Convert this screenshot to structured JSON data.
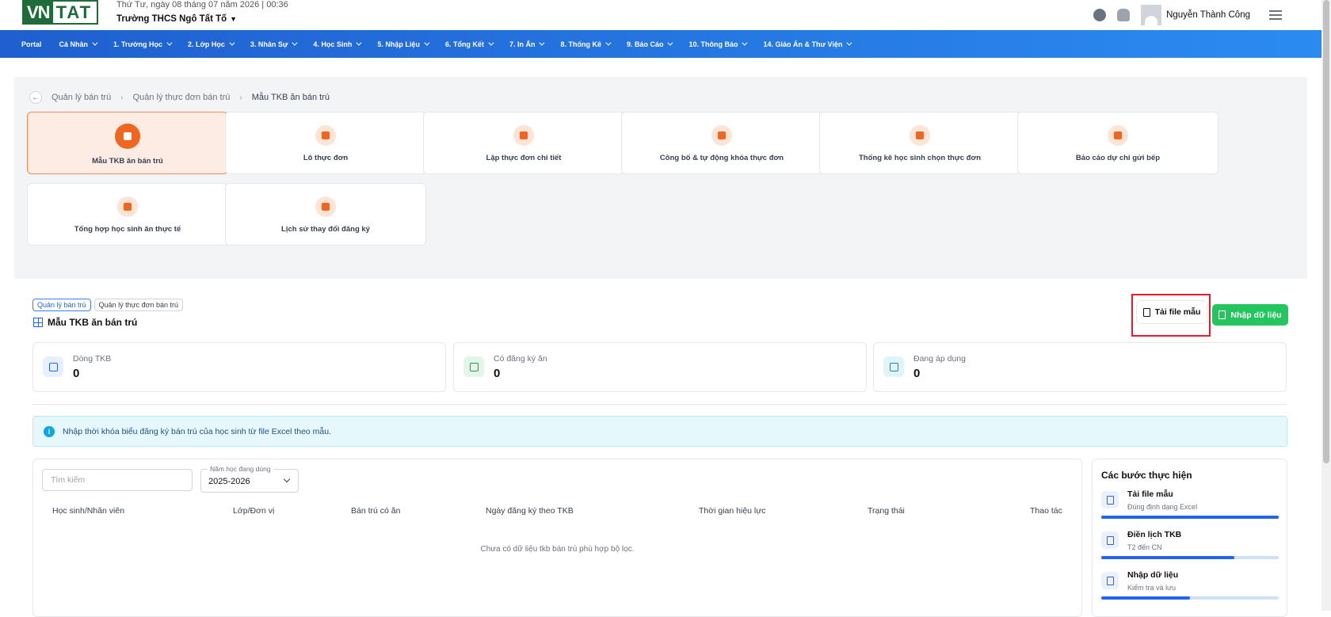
{
  "header": {
    "logo_left": "VN",
    "logo_right": "TAT",
    "date": "Thứ Tư, ngày 08 tháng 07 năm 2026 | 00:36",
    "school": "Trường THCS Ngô Tất Tố",
    "user_name": "Nguyễn Thành Công"
  },
  "nav": [
    {
      "label": "Portal",
      "dropdown": false
    },
    {
      "label": "Cá Nhân",
      "dropdown": true
    },
    {
      "label": "1. Trường Học",
      "dropdown": true
    },
    {
      "label": "2. Lớp Học",
      "dropdown": true
    },
    {
      "label": "3. Nhân Sự",
      "dropdown": true
    },
    {
      "label": "4. Học Sinh",
      "dropdown": true
    },
    {
      "label": "5. Nhập Liệu",
      "dropdown": true
    },
    {
      "label": "6. Tổng Kết",
      "dropdown": true
    },
    {
      "label": "7. In Ấn",
      "dropdown": true
    },
    {
      "label": "8. Thống Kê",
      "dropdown": true
    },
    {
      "label": "9. Báo Cáo",
      "dropdown": true
    },
    {
      "label": "10. Thông Báo",
      "dropdown": true
    },
    {
      "label": "14. Giáo Án & Thư Viện",
      "dropdown": true
    }
  ],
  "breadcrumb": [
    "Quản lý bán trú",
    "Quản lý thực đơn bán trú",
    "Mẫu TKB ăn bán trú"
  ],
  "cards": [
    {
      "label": "Mẫu TKB ăn bán trú",
      "active": true
    },
    {
      "label": "Lô thực đơn",
      "active": false
    },
    {
      "label": "Lập thực đơn chi tiết",
      "active": false
    },
    {
      "label": "Công bố & tự động khóa thực đơn",
      "active": false
    },
    {
      "label": "Thống kê học sinh chọn thực đơn",
      "active": false
    },
    {
      "label": "Báo cáo dự chi gửi bếp",
      "active": false
    },
    {
      "label": "Tổng hợp học sinh ăn thực tế",
      "active": false
    },
    {
      "label": "Lịch sử thay đổi đăng ký",
      "active": false
    }
  ],
  "section": {
    "tags": [
      "Quản lý bán trú",
      "Quản lý thực đơn bán trú"
    ],
    "title": "Mẫu TKB ăn bán trú",
    "download_button": "Tải file mẫu",
    "import_button": "Nhập dữ liệu"
  },
  "stats": [
    {
      "label": "Dòng TKB",
      "value": "0",
      "color": "#2563eb",
      "bg": "#e8f0fe"
    },
    {
      "label": "Có đăng ký ăn",
      "value": "0",
      "color": "#16a34a",
      "bg": "#e3f6e9"
    },
    {
      "label": "Đang áp dụng",
      "value": "0",
      "color": "#0891b2",
      "bg": "#dff5f8"
    }
  ],
  "info_text": "Nhập thời khóa biểu đăng ký bán trú của học sinh từ file Excel theo mẫu.",
  "table": {
    "search_placeholder": "Tìm kiếm",
    "year_label": "Năm học đang dùng",
    "year_value": "2025-2026",
    "columns": [
      "Học sinh/Nhân viên",
      "Lớp/Đơn vị",
      "Bán trú có ăn",
      "Ngày đăng ký theo TKB",
      "Thời gian hiệu lực",
      "Trạng thái",
      "Thao tác"
    ],
    "empty": "Chưa có dữ liệu tkb bán trú phù hợp bộ lọc."
  },
  "steps": {
    "title": "Các bước thực hiện",
    "items": [
      {
        "name": "Tải file mẫu",
        "desc": "Đúng định dạng Excel",
        "progress": 1.0
      },
      {
        "name": "Điền lịch TKB",
        "desc": "T2 đến CN",
        "progress": 0.75
      },
      {
        "name": "Nhập dữ liệu",
        "desc": "Kiểm tra và lưu",
        "progress": 0.5
      }
    ]
  },
  "colors": {
    "accent": "#2563eb",
    "active_card": "#f0651f",
    "success": "#22c55e",
    "highlight": "#e8192c"
  }
}
